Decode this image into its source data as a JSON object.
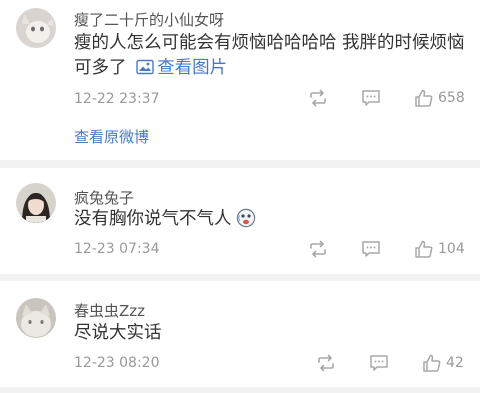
{
  "comments": [
    {
      "username": "瘦了二十斤的小仙女呀",
      "text": "瘦的人怎么可能会有烦恼哈哈哈哈 我胖的时候烦恼可多了",
      "image_link_label": "查看图片",
      "time": "12-22 23:37",
      "likes": "658",
      "view_original_label": "查看原微博"
    },
    {
      "username": "疯兔兔子",
      "text": "没有胸你说气不气人",
      "time": "12-23 07:34",
      "likes": "104"
    },
    {
      "username": "春虫虫Zzz",
      "text": "尽说大实话",
      "time": "12-23 08:20",
      "likes": "42"
    }
  ],
  "icons": [
    "repost-icon",
    "comment-icon",
    "like-icon",
    "image-icon",
    "emoji-icon"
  ],
  "colors": {
    "link": "#4a78c8",
    "meta": "#999999",
    "divider": "#f2f2f2"
  }
}
